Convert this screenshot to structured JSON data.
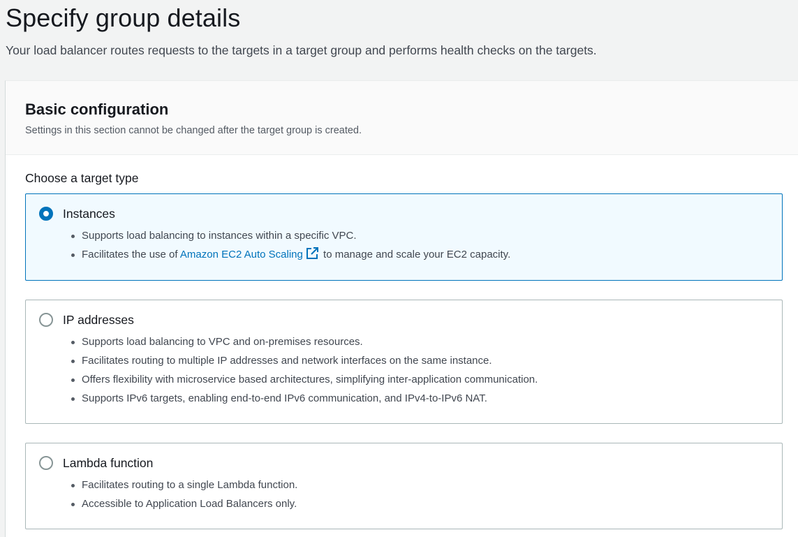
{
  "header": {
    "title": "Specify group details",
    "description": "Your load balancer routes requests to the targets in a target group and performs health checks on the targets."
  },
  "basic_config": {
    "title": "Basic configuration",
    "description": "Settings in this section cannot be changed after the target group is created.",
    "target_type_label": "Choose a target type"
  },
  "target_types": [
    {
      "title": "Instances",
      "selected": true,
      "bullets": [
        "Supports load balancing to instances within a specific VPC.",
        {
          "prefix": "Facilitates the use of ",
          "link": "Amazon EC2 Auto Scaling",
          "suffix": " to manage and scale your EC2 capacity."
        }
      ]
    },
    {
      "title": "IP addresses",
      "selected": false,
      "bullets": [
        "Supports load balancing to VPC and on-premises resources.",
        "Facilitates routing to multiple IP addresses and network interfaces on the same instance.",
        "Offers flexibility with microservice based architectures, simplifying inter-application communication.",
        "Supports IPv6 targets, enabling end-to-end IPv6 communication, and IPv4-to-IPv6 NAT."
      ]
    },
    {
      "title": "Lambda function",
      "selected": false,
      "bullets": [
        "Facilitates routing to a single Lambda function.",
        "Accessible to Application Load Balancers only."
      ]
    }
  ],
  "icons": {
    "external_link": "external-link-icon"
  },
  "colors": {
    "accent": "#0073bb",
    "selected_tile_bg": "#f1faff",
    "page_bg": "#f2f3f3"
  }
}
